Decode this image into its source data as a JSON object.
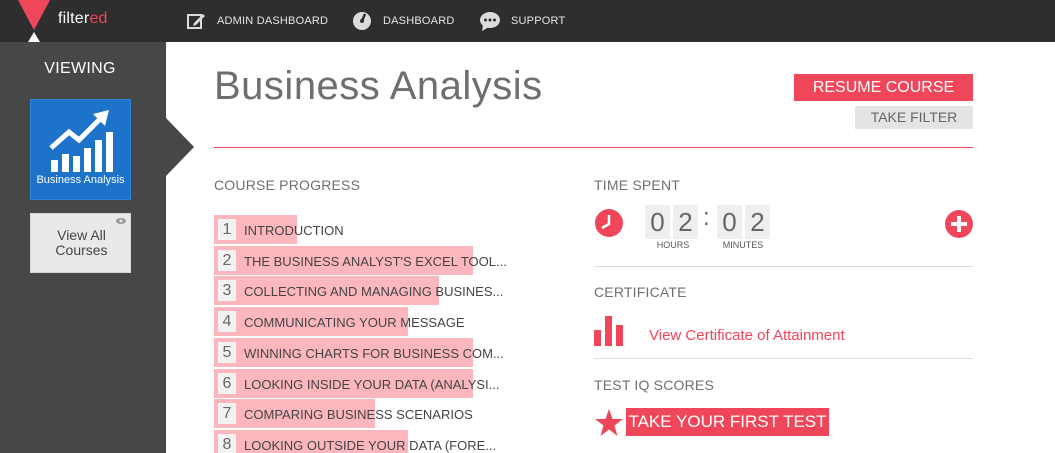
{
  "brand": {
    "name_main": "filter",
    "name_accent": "ed",
    "accent_color": "#f0465a"
  },
  "nav": [
    {
      "label": "ADMIN DASHBOARD",
      "icon": "edit-icon"
    },
    {
      "label": "DASHBOARD",
      "icon": "gauge-icon"
    },
    {
      "label": "SUPPORT",
      "icon": "chat-bubble-icon"
    }
  ],
  "sidebar": {
    "viewing_label": "VIEWING",
    "course_thumb_label": "Business Analysis",
    "course_thumb_icon": "growth-chart-icon",
    "view_all_label": "View All Courses",
    "view_all_icon": "eye-icon"
  },
  "course": {
    "title": "Business Analysis",
    "resume_label": "RESUME COURSE",
    "filter_label": "TAKE FILTER"
  },
  "progress": {
    "heading": "COURSE PROGRESS",
    "modules": [
      {
        "number": "1",
        "title": "INTRODUCTION",
        "progress": 0.32
      },
      {
        "number": "2",
        "title": "THE BUSINESS ANALYST'S EXCEL TOOL...",
        "progress": 1.0
      },
      {
        "number": "3",
        "title": "COLLECTING AND MANAGING BUSINES...",
        "progress": 0.87
      },
      {
        "number": "4",
        "title": "COMMUNICATING YOUR MESSAGE",
        "progress": 0.75
      },
      {
        "number": "5",
        "title": "WINNING CHARTS FOR BUSINESS COM...",
        "progress": 1.0
      },
      {
        "number": "6",
        "title": "LOOKING INSIDE YOUR DATA (ANALYSI...",
        "progress": 1.0
      },
      {
        "number": "7",
        "title": "COMPARING BUSINESS SCENARIOS",
        "progress": 0.62
      },
      {
        "number": "8",
        "title": "LOOKING OUTSIDE YOUR DATA (FORE...",
        "progress": 0.75
      }
    ]
  },
  "time_spent": {
    "heading": "TIME SPENT",
    "hours_digits": [
      "0",
      "2"
    ],
    "minutes_digits": [
      "0",
      "2"
    ],
    "separator": ":",
    "hours_label": "HOURS",
    "minutes_label": "MINUTES",
    "clock_icon": "clock-icon",
    "add_icon": "plus-circle-icon"
  },
  "certificate": {
    "heading": "CERTIFICATE",
    "link_label": "View Certificate of Attainment",
    "icon": "bar-chart-icon"
  },
  "tests": {
    "heading": "TEST IQ SCORES",
    "button_label": "TAKE YOUR FIRST TEST",
    "icon": "star-icon"
  }
}
